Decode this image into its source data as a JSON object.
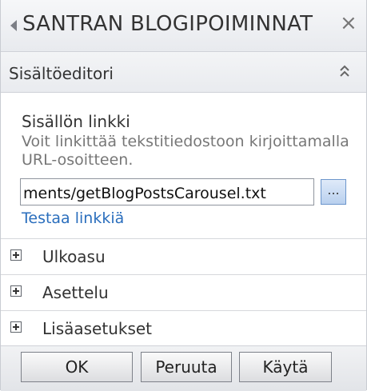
{
  "header": {
    "title": "SANTRAN BLOGIPOIMINNAT",
    "back_icon": "left-arrow-icon",
    "close_glyph": "×"
  },
  "section": {
    "title": "Sisältöeditori",
    "collapse_icon": "double-chevron-up-icon"
  },
  "content_link": {
    "label": "Sisällön linkki",
    "help_text": "Voit linkittää tekstitiedostoon kirjoittamalla URL-osoitteen.",
    "value": "ments/getBlogPostsCarousel.txt",
    "browse_label": "...",
    "test_link": "Testaa linkkiä"
  },
  "collapsed_sections": [
    {
      "label": "Ulkoasu"
    },
    {
      "label": "Asettelu"
    },
    {
      "label": "Lisäasetukset"
    }
  ],
  "buttons": {
    "ok": "OK",
    "cancel": "Peruuta",
    "apply": "Käytä"
  }
}
